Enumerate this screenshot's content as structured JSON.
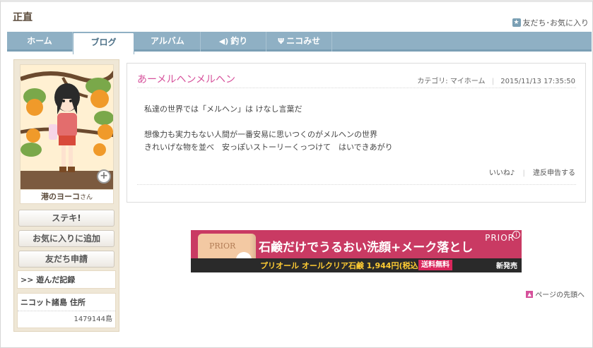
{
  "header": {
    "title": "正直",
    "friends_link": "友だち･お気に入り",
    "friends_icon": "star-icon"
  },
  "tabs": [
    {
      "label": "ホーム",
      "icon": ""
    },
    {
      "label": "ブログ",
      "icon": "",
      "active": true
    },
    {
      "label": "アルバム",
      "icon": ""
    },
    {
      "label": "釣り",
      "icon": "◀)"
    },
    {
      "label": "ニコみせ",
      "icon": "Ψ"
    }
  ],
  "sidebar": {
    "owner_name": "港のヨーコ",
    "owner_suffix": "さん",
    "zoom_icon": "magnify-icon",
    "buttons": [
      "ステキ!",
      "お気に入りに追加",
      "友だち申請"
    ],
    "played_record": ">> 遊んだ記録",
    "address_label": "ニコット諸島 住所",
    "address_value": "1479144島"
  },
  "post": {
    "title": "あーメルヘンメルヘン",
    "category_label": "カテゴリ:",
    "category_value": "マイホーム",
    "datetime": "2015/11/13 17:35:50",
    "body": [
      "私達の世界では「メルヘン」は けなし言葉だ",
      "",
      "想像力も実力もない人間が一番安易に思いつくのがメルヘンの世界",
      "きれいげな物を並べ　安っぽいストーリーくっつけて　はいできあがり"
    ],
    "like": "いいね♪",
    "report": "違反申告する"
  },
  "ad": {
    "headline": "石鹸だけでうるおい洗顔+メーク落とし",
    "brand": "PRIOR",
    "soap_label": "PRIOR",
    "product": "プリオール オールクリア石鹸 1,944円(税込)",
    "free_shipping": "送料無料",
    "new_label": "新発売",
    "info": "i"
  },
  "footer": {
    "page_top": "ページの先頭へ"
  },
  "colors": {
    "tab_bar": "#8fb0c4",
    "post_title": "#d6519b",
    "ad_bg": "#c93a63",
    "sidebar_bg": "#efe7d6"
  }
}
